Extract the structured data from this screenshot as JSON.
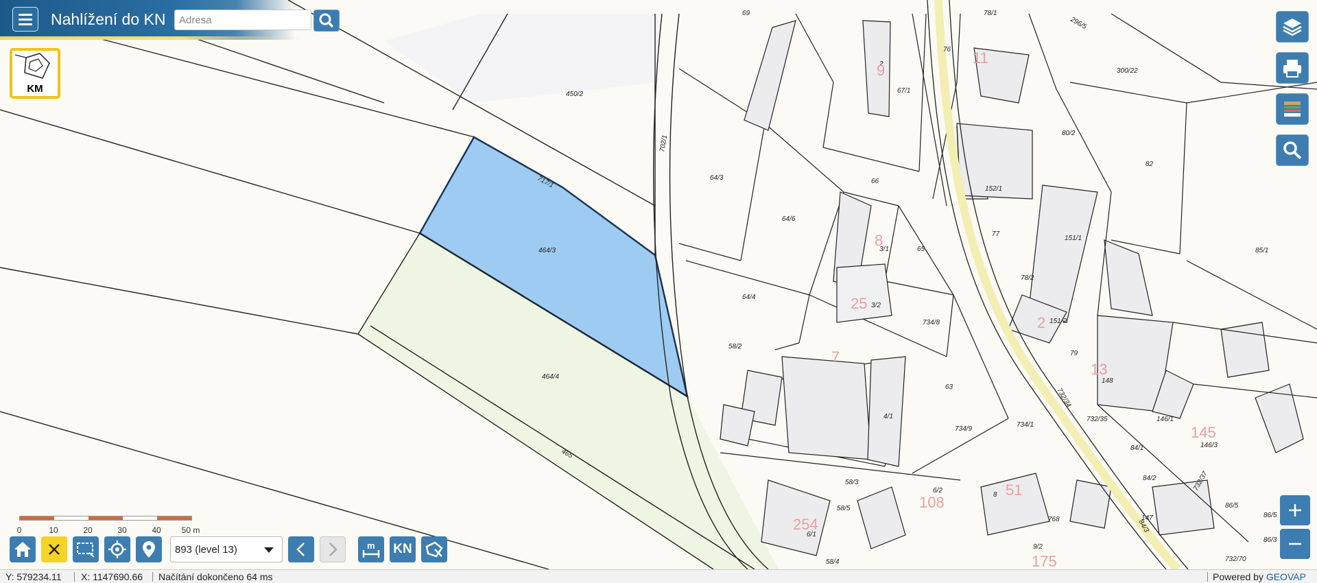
{
  "header": {
    "title": "Nahlížení do KN",
    "search_placeholder": "Adresa"
  },
  "layer_badge": {
    "label": "KM"
  },
  "map": {
    "selected_parcel": "464/3",
    "highlight_colors": {
      "selected_fill": "#9ecbf2",
      "selected_stroke": "#1d3557",
      "adjacent_fill": "#eef5e2"
    },
    "parcel_labels": [
      "450/2",
      "717/1",
      "464/3",
      "464/4",
      "465",
      "702/1",
      "64/3",
      "64/6",
      "64/4",
      "58/2",
      "66",
      "3/1",
      "65",
      "3/2",
      "734/8",
      "63",
      "4/1",
      "734/9",
      "734/1",
      "58/3",
      "58/5",
      "6/2",
      "6/1",
      "58/4",
      "69",
      "67/1",
      "76",
      "78/1",
      "296/5",
      "300/22",
      "80/2",
      "82",
      "152/1",
      "77",
      "151/1",
      "85/1",
      "78/2",
      "151/2",
      "79",
      "148",
      "146/1",
      "146/3",
      "732/35",
      "84/1",
      "84/2",
      "147",
      "768",
      "9/2",
      "732/34",
      "732/37",
      "86/5",
      "86/5",
      "86/3",
      "732/70",
      "84/3",
      "2",
      "8"
    ],
    "house_numbers": [
      "9",
      "11",
      "8",
      "25",
      "7",
      "2",
      "13",
      "145",
      "108",
      "254",
      "175",
      "51"
    ]
  },
  "scale": {
    "ticks": [
      "0",
      "10",
      "20",
      "30",
      "40",
      "50 m"
    ]
  },
  "toolbar": {
    "level": "893 (level 13)",
    "kn_label": "KN"
  },
  "status": {
    "y": "Y: 579234.11",
    "x": "X: 1147690.66",
    "message": "Načítání dokončeno 64 ms",
    "powered_prefix": "Powered by ",
    "powered_brand": "GEOVAP"
  }
}
